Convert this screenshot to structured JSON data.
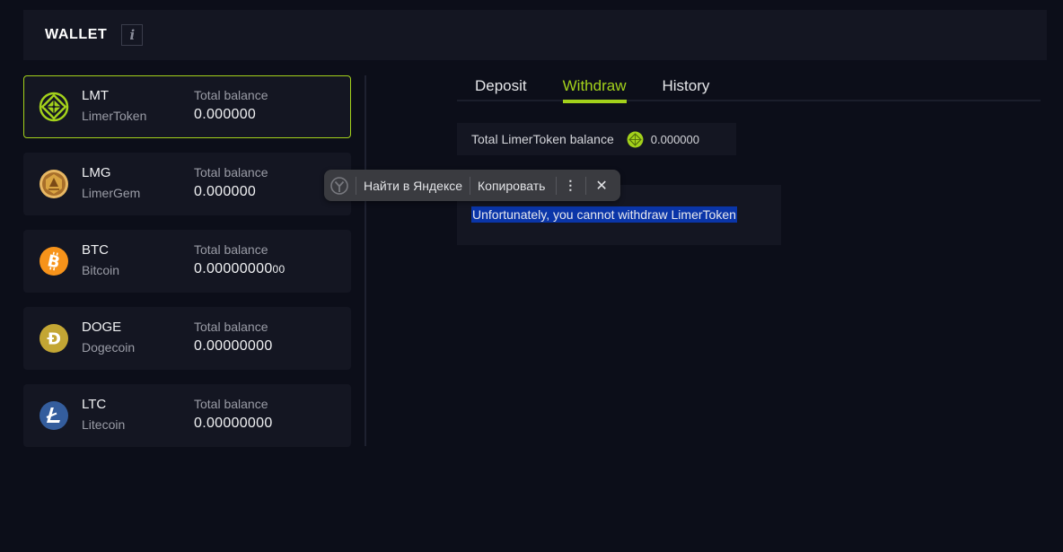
{
  "header": {
    "title": "WALLET",
    "info_icon": "info-icon"
  },
  "wallets": [
    {
      "symbol": "LMT",
      "name": "LimerToken",
      "balance_label": "Total balance",
      "balance": "0.000000",
      "balance_suffix": "",
      "icon": "limertoken-icon",
      "color": "#a3d11b",
      "active": true
    },
    {
      "symbol": "LMG",
      "name": "LimerGem",
      "balance_label": "Total balance",
      "balance": "0.000000",
      "balance_suffix": "",
      "icon": "limergem-icon",
      "color": "#d9a441",
      "active": false
    },
    {
      "symbol": "BTC",
      "name": "Bitcoin",
      "balance_label": "Total balance",
      "balance": "0.00000000",
      "balance_suffix": "00",
      "icon": "bitcoin-icon",
      "color": "#f7931a",
      "active": false
    },
    {
      "symbol": "DOGE",
      "name": "Dogecoin",
      "balance_label": "Total balance",
      "balance": "0.00000000",
      "balance_suffix": "",
      "icon": "dogecoin-icon",
      "color": "#c3a634",
      "active": false
    },
    {
      "symbol": "LTC",
      "name": "Litecoin",
      "balance_label": "Total balance",
      "balance": "0.00000000",
      "balance_suffix": "",
      "icon": "litecoin-icon",
      "color": "#345d9d",
      "active": false
    }
  ],
  "tabs": [
    {
      "label": "Deposit",
      "active": false
    },
    {
      "label": "Withdraw",
      "active": true
    },
    {
      "label": "History",
      "active": false
    }
  ],
  "withdraw": {
    "balance_label": "Total LimerToken balance",
    "balance_value": "0.000000",
    "notice": "Unfortunately, you cannot withdraw LimerToken"
  },
  "context_menu": {
    "search_label": "Найти в Яндексе",
    "copy_label": "Копировать",
    "more_icon": "⋮",
    "close_icon": "✕"
  },
  "colors": {
    "accent": "#a3d11b",
    "background": "#0c0e19",
    "card": "#141622",
    "selection": "#0a35a8"
  }
}
